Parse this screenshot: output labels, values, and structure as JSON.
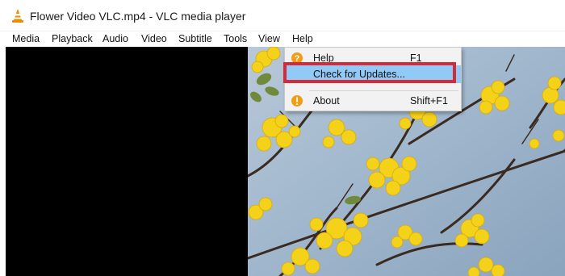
{
  "window": {
    "title": "Flower Video VLC.mp4 - VLC media player",
    "icon": "vlc-cone-icon"
  },
  "menubar": {
    "items": [
      "Media",
      "Playback",
      "Audio",
      "Video",
      "Subtitle",
      "Tools",
      "View",
      "Help"
    ]
  },
  "help_menu": {
    "items": [
      {
        "label": "Help",
        "shortcut": "F1",
        "icon": "help-question-icon"
      },
      {
        "label": "Check for Updates...",
        "shortcut": "",
        "icon": ""
      },
      {
        "label": "About",
        "shortcut": "Shift+F1",
        "icon": "info-icon"
      }
    ]
  },
  "colors": {
    "highlight": "#91c9f7",
    "annotation_box": "#d42b3a",
    "icon_orange": "#f39c12",
    "sky": "#9fb6cc",
    "flower": "#f5d21a"
  }
}
